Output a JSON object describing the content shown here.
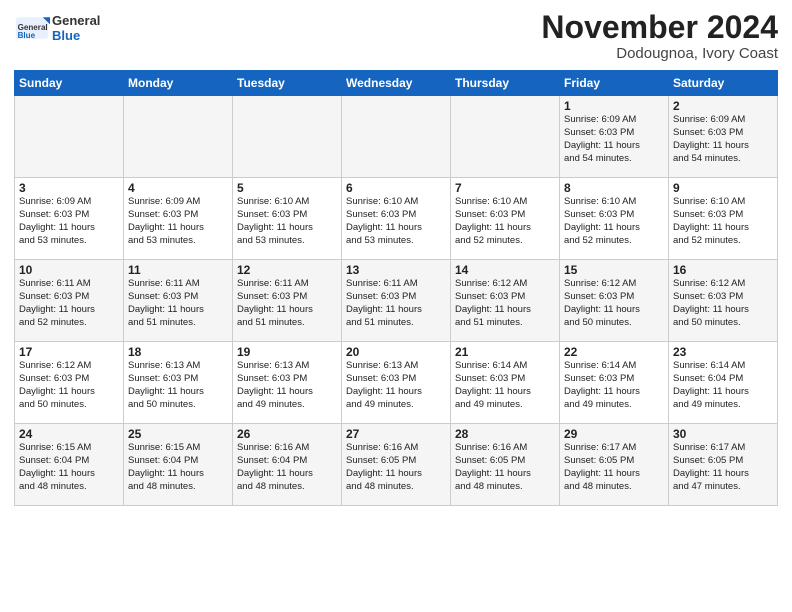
{
  "header": {
    "logo_general": "General",
    "logo_blue": "Blue",
    "month": "November 2024",
    "location": "Dodougnoa, Ivory Coast"
  },
  "weekdays": [
    "Sunday",
    "Monday",
    "Tuesday",
    "Wednesday",
    "Thursday",
    "Friday",
    "Saturday"
  ],
  "weeks": [
    [
      {
        "day": "",
        "info": ""
      },
      {
        "day": "",
        "info": ""
      },
      {
        "day": "",
        "info": ""
      },
      {
        "day": "",
        "info": ""
      },
      {
        "day": "",
        "info": ""
      },
      {
        "day": "1",
        "info": "Sunrise: 6:09 AM\nSunset: 6:03 PM\nDaylight: 11 hours\nand 54 minutes."
      },
      {
        "day": "2",
        "info": "Sunrise: 6:09 AM\nSunset: 6:03 PM\nDaylight: 11 hours\nand 54 minutes."
      }
    ],
    [
      {
        "day": "3",
        "info": "Sunrise: 6:09 AM\nSunset: 6:03 PM\nDaylight: 11 hours\nand 53 minutes."
      },
      {
        "day": "4",
        "info": "Sunrise: 6:09 AM\nSunset: 6:03 PM\nDaylight: 11 hours\nand 53 minutes."
      },
      {
        "day": "5",
        "info": "Sunrise: 6:10 AM\nSunset: 6:03 PM\nDaylight: 11 hours\nand 53 minutes."
      },
      {
        "day": "6",
        "info": "Sunrise: 6:10 AM\nSunset: 6:03 PM\nDaylight: 11 hours\nand 53 minutes."
      },
      {
        "day": "7",
        "info": "Sunrise: 6:10 AM\nSunset: 6:03 PM\nDaylight: 11 hours\nand 52 minutes."
      },
      {
        "day": "8",
        "info": "Sunrise: 6:10 AM\nSunset: 6:03 PM\nDaylight: 11 hours\nand 52 minutes."
      },
      {
        "day": "9",
        "info": "Sunrise: 6:10 AM\nSunset: 6:03 PM\nDaylight: 11 hours\nand 52 minutes."
      }
    ],
    [
      {
        "day": "10",
        "info": "Sunrise: 6:11 AM\nSunset: 6:03 PM\nDaylight: 11 hours\nand 52 minutes."
      },
      {
        "day": "11",
        "info": "Sunrise: 6:11 AM\nSunset: 6:03 PM\nDaylight: 11 hours\nand 51 minutes."
      },
      {
        "day": "12",
        "info": "Sunrise: 6:11 AM\nSunset: 6:03 PM\nDaylight: 11 hours\nand 51 minutes."
      },
      {
        "day": "13",
        "info": "Sunrise: 6:11 AM\nSunset: 6:03 PM\nDaylight: 11 hours\nand 51 minutes."
      },
      {
        "day": "14",
        "info": "Sunrise: 6:12 AM\nSunset: 6:03 PM\nDaylight: 11 hours\nand 51 minutes."
      },
      {
        "day": "15",
        "info": "Sunrise: 6:12 AM\nSunset: 6:03 PM\nDaylight: 11 hours\nand 50 minutes."
      },
      {
        "day": "16",
        "info": "Sunrise: 6:12 AM\nSunset: 6:03 PM\nDaylight: 11 hours\nand 50 minutes."
      }
    ],
    [
      {
        "day": "17",
        "info": "Sunrise: 6:12 AM\nSunset: 6:03 PM\nDaylight: 11 hours\nand 50 minutes."
      },
      {
        "day": "18",
        "info": "Sunrise: 6:13 AM\nSunset: 6:03 PM\nDaylight: 11 hours\nand 50 minutes."
      },
      {
        "day": "19",
        "info": "Sunrise: 6:13 AM\nSunset: 6:03 PM\nDaylight: 11 hours\nand 49 minutes."
      },
      {
        "day": "20",
        "info": "Sunrise: 6:13 AM\nSunset: 6:03 PM\nDaylight: 11 hours\nand 49 minutes."
      },
      {
        "day": "21",
        "info": "Sunrise: 6:14 AM\nSunset: 6:03 PM\nDaylight: 11 hours\nand 49 minutes."
      },
      {
        "day": "22",
        "info": "Sunrise: 6:14 AM\nSunset: 6:03 PM\nDaylight: 11 hours\nand 49 minutes."
      },
      {
        "day": "23",
        "info": "Sunrise: 6:14 AM\nSunset: 6:04 PM\nDaylight: 11 hours\nand 49 minutes."
      }
    ],
    [
      {
        "day": "24",
        "info": "Sunrise: 6:15 AM\nSunset: 6:04 PM\nDaylight: 11 hours\nand 48 minutes."
      },
      {
        "day": "25",
        "info": "Sunrise: 6:15 AM\nSunset: 6:04 PM\nDaylight: 11 hours\nand 48 minutes."
      },
      {
        "day": "26",
        "info": "Sunrise: 6:16 AM\nSunset: 6:04 PM\nDaylight: 11 hours\nand 48 minutes."
      },
      {
        "day": "27",
        "info": "Sunrise: 6:16 AM\nSunset: 6:05 PM\nDaylight: 11 hours\nand 48 minutes."
      },
      {
        "day": "28",
        "info": "Sunrise: 6:16 AM\nSunset: 6:05 PM\nDaylight: 11 hours\nand 48 minutes."
      },
      {
        "day": "29",
        "info": "Sunrise: 6:17 AM\nSunset: 6:05 PM\nDaylight: 11 hours\nand 48 minutes."
      },
      {
        "day": "30",
        "info": "Sunrise: 6:17 AM\nSunset: 6:05 PM\nDaylight: 11 hours\nand 47 minutes."
      }
    ]
  ]
}
